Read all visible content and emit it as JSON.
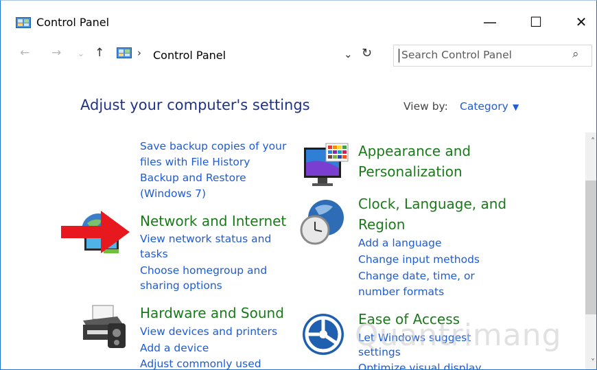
{
  "window": {
    "title": "Control Panel",
    "minimize": "—",
    "maximize": "☐",
    "close": "✕"
  },
  "address": {
    "back": "←",
    "forward": "→",
    "recent": "⌄",
    "up": "↑",
    "separator": "›",
    "path": "Control Panel",
    "dropdown": "⌄",
    "refresh": "↻"
  },
  "search": {
    "placeholder": "Search Control Panel",
    "icon": "⌕"
  },
  "main": {
    "heading": "Adjust your computer's settings",
    "view_by_label": "View by:",
    "view_by_value": "Category",
    "view_by_caret": "▼"
  },
  "categories": {
    "system_links": [
      "Save backup copies of your",
      "files with File History",
      "Backup and Restore",
      "(Windows 7)"
    ],
    "network": {
      "title": "Network and Internet",
      "links": [
        "View network status and",
        "tasks",
        "Choose homegroup and",
        "sharing options"
      ]
    },
    "hardware": {
      "title": "Hardware and Sound",
      "links": [
        "View devices and printers",
        "Add a device",
        "Adjust commonly used"
      ]
    },
    "appearance": {
      "title_line1": "Appearance and",
      "title_line2": "Personalization"
    },
    "clock": {
      "title_line1": "Clock, Language, and",
      "title_line2": "Region",
      "links": [
        "Add a language",
        "Change input methods",
        "Change date, time, or",
        "number formats"
      ]
    },
    "ease": {
      "title": "Ease of Access",
      "links": [
        "Let Windows suggest",
        "settings",
        "Optimize visual display"
      ]
    }
  },
  "scroll": {
    "up": "˄",
    "down": "˅"
  },
  "watermark": "Quantrimang",
  "colors": {
    "heading": "#1e3287",
    "link": "#1e5bd6",
    "category": "#1a7a1a",
    "arrow": "#e8191e"
  }
}
